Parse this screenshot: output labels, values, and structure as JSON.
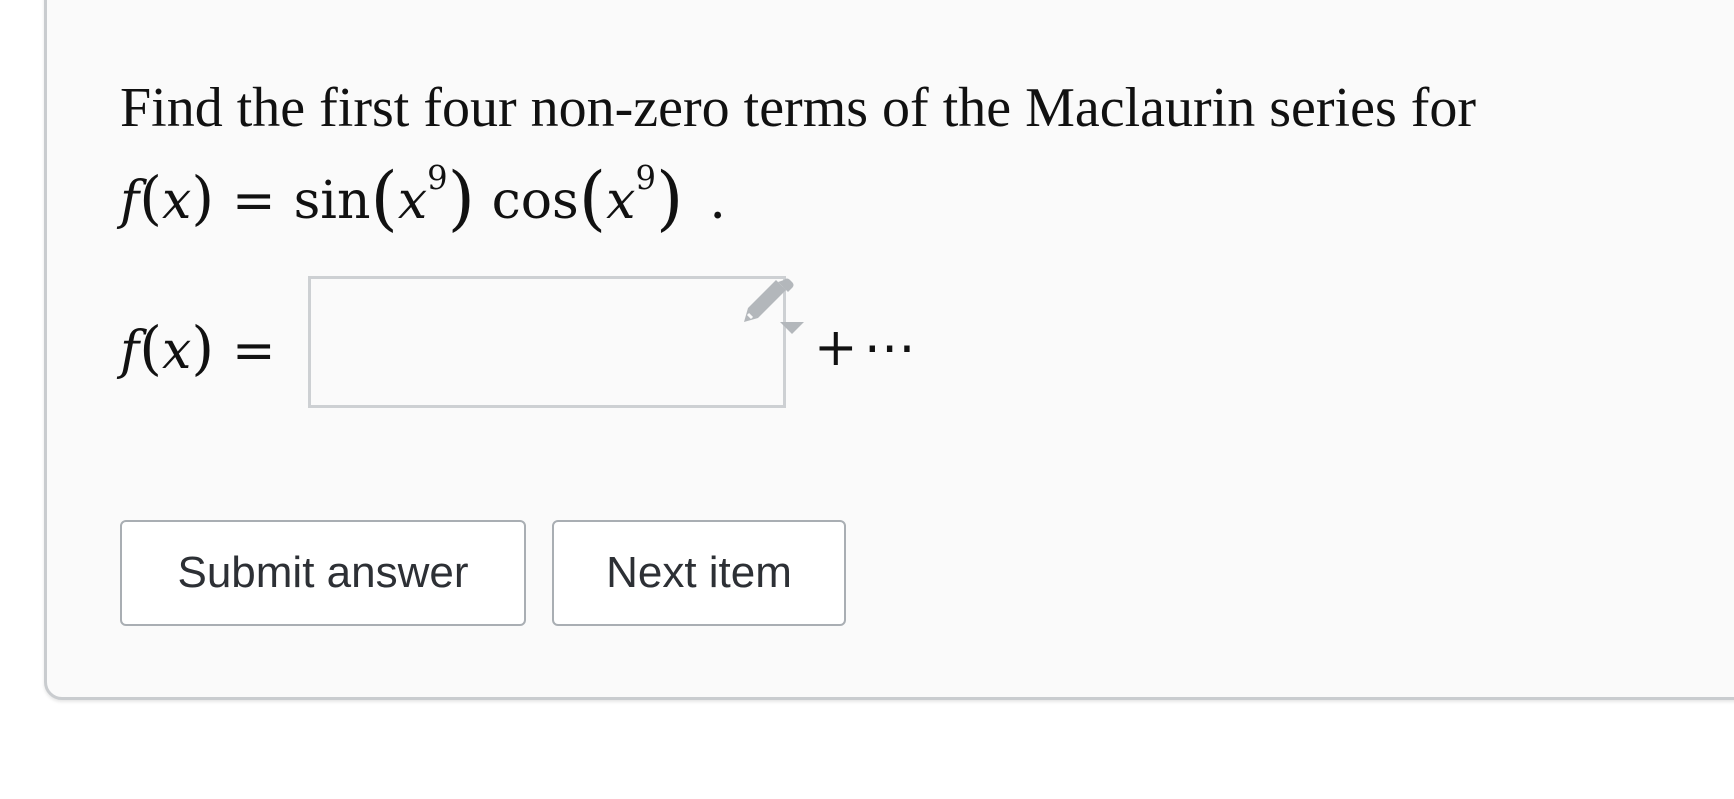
{
  "question": {
    "prompt_text": "Find the first four non-zero terms of the Maclaurin series for",
    "function_line": {
      "lhs_fn": "f",
      "lhs_var": "x",
      "equals": "=",
      "sin": "sin",
      "cos": "cos",
      "base": "x",
      "exponent": "9",
      "period": "."
    }
  },
  "answer": {
    "lhs_fn": "f",
    "lhs_var": "x",
    "equals": "=",
    "value": "",
    "trailing": "+⋯",
    "editor_icon": "pencil-dropdown-icon"
  },
  "buttons": {
    "submit_label": "Submit answer",
    "next_label": "Next item"
  },
  "colors": {
    "card_bg": "#fafafa",
    "card_border": "#c9cccf",
    "text": "#111111",
    "button_text": "#2d3035",
    "button_border": "#a9aeb3",
    "icon": "#b3b7bb"
  }
}
